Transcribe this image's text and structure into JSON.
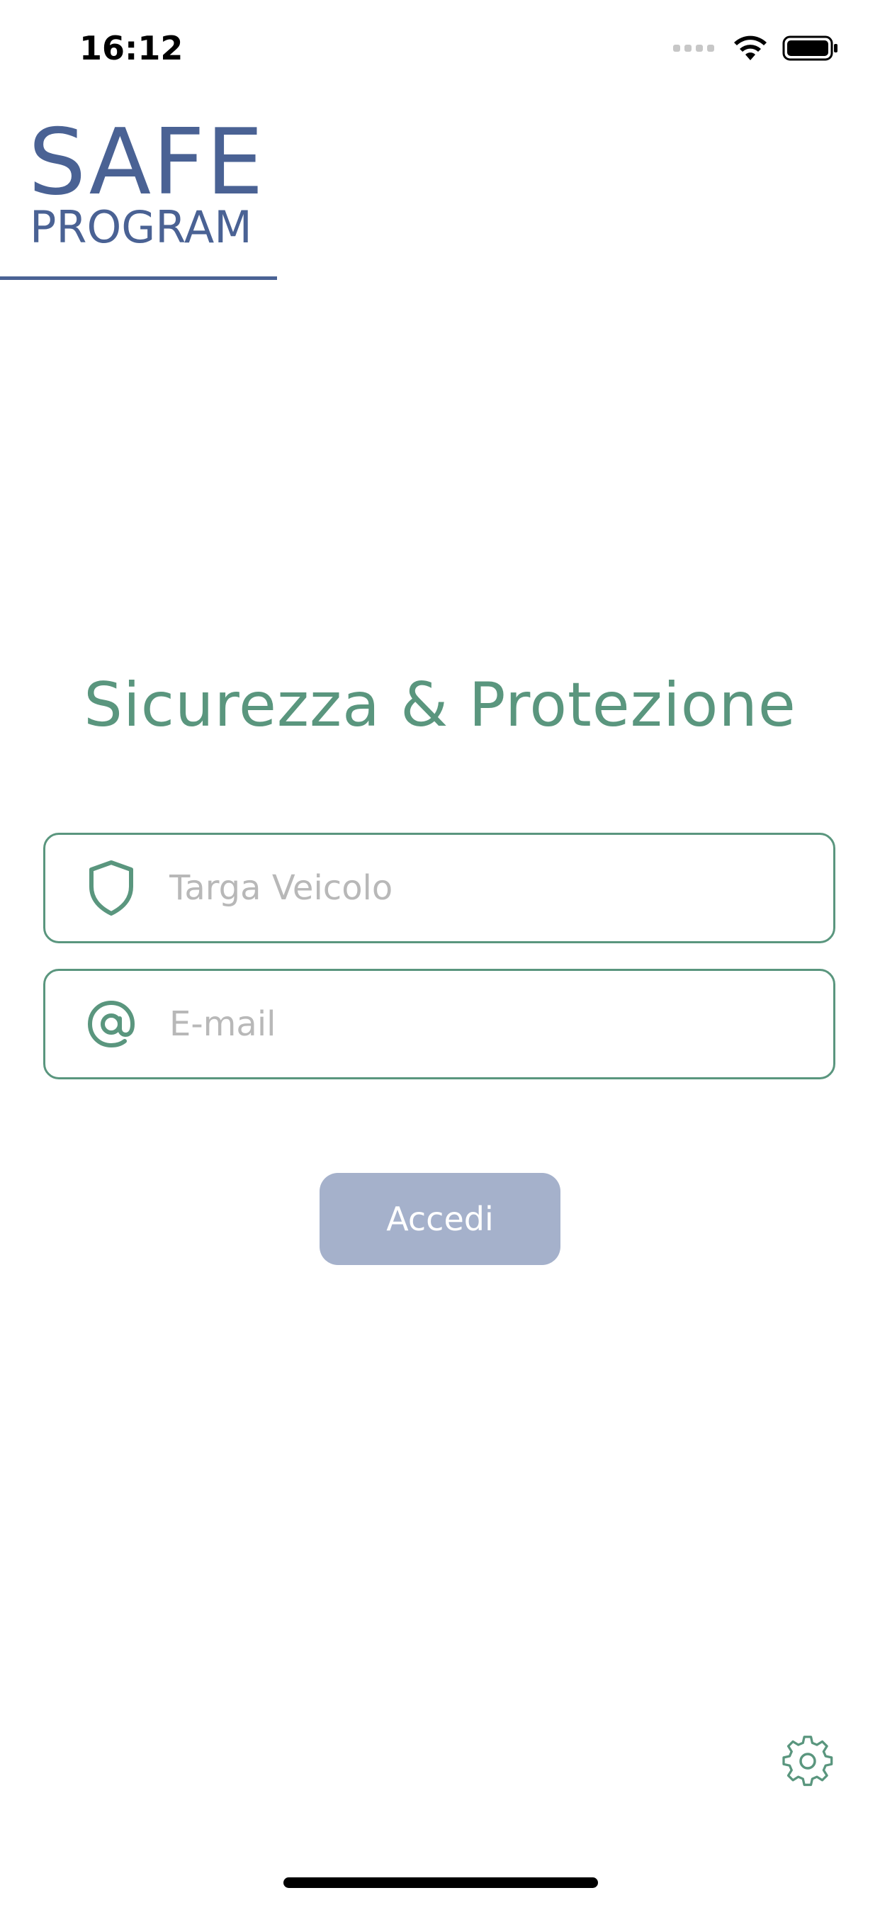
{
  "status_bar": {
    "time": "16:12",
    "icons": [
      "cellular-signal-icon",
      "wifi-icon",
      "battery-icon"
    ]
  },
  "logo": {
    "line1": "SAFE",
    "line2": "PROGRAM"
  },
  "headline": "Sicurezza & Protezione",
  "form": {
    "plate_field": {
      "icon": "shield-icon",
      "placeholder": "Targa Veicolo",
      "value": ""
    },
    "email_field": {
      "icon": "at-sign-icon",
      "placeholder": "E-mail",
      "value": ""
    },
    "submit_label": "Accedi"
  },
  "settings": {
    "icon": "gear-icon"
  },
  "colors": {
    "brand_blue": "#4a6294",
    "accent_green": "#5a967e",
    "button_disabled": "#a5b1cb",
    "placeholder_gray": "#b8b8b8"
  }
}
